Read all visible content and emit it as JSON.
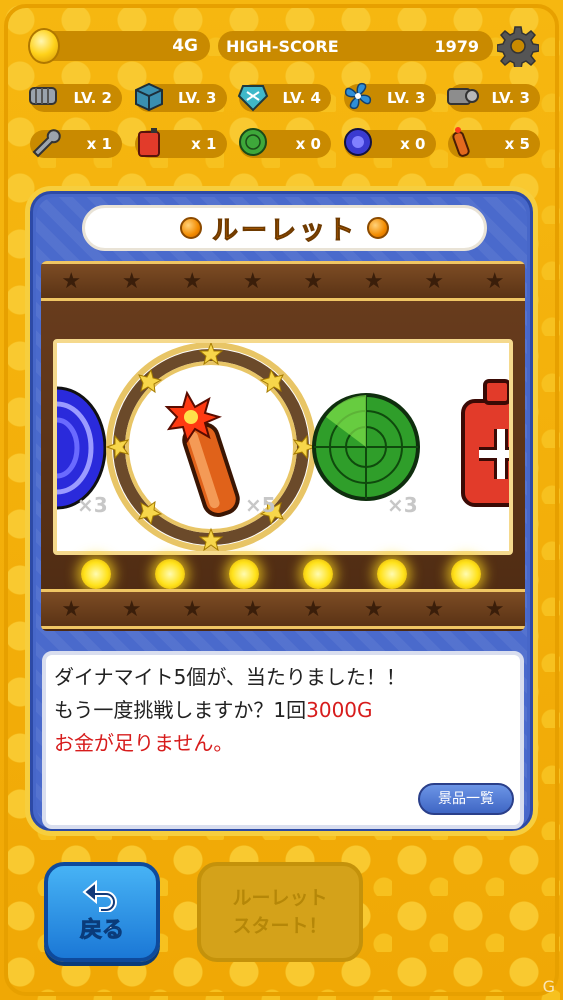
{
  "top_bar": {
    "gold": "4G",
    "high_score_label": "HIGH-SCORE",
    "high_score_value": "1979"
  },
  "levels": [
    {
      "icon": "drill-icon",
      "label": "LV. 2"
    },
    {
      "icon": "box-icon",
      "label": "LV. 3"
    },
    {
      "icon": "gem-icon",
      "label": "LV. 4"
    },
    {
      "icon": "fan-icon",
      "label": "LV. 3"
    },
    {
      "icon": "engine-icon",
      "label": "LV. 3"
    }
  ],
  "items": [
    {
      "icon": "wrench-icon",
      "label": "x 1"
    },
    {
      "icon": "fuel-can-icon",
      "label": "x 1"
    },
    {
      "icon": "radar-icon",
      "label": "x 0"
    },
    {
      "icon": "vortex-icon",
      "label": "x 0"
    },
    {
      "icon": "dynamite-icon",
      "label": "x 5"
    }
  ],
  "panel": {
    "title": "ルーレット",
    "reel": {
      "vortex_mult": "×3",
      "dynamite_mult": "×5",
      "radar_mult": "×3"
    },
    "message": {
      "line1": "ダイナマイト5個が、当たりました！！",
      "line2_prefix": "もう一度挑戦しますか？1回",
      "line2_price": "3000G",
      "line3": "お金が足りません。"
    },
    "prize_list_button": "景品一覧"
  },
  "buttons": {
    "back": "戻る",
    "start": "ルーレット\nスタート！"
  },
  "watermark": "G",
  "colors": {
    "background": "#f4b50c",
    "panel": "#4767c9",
    "accent_red": "#d71c1c"
  }
}
